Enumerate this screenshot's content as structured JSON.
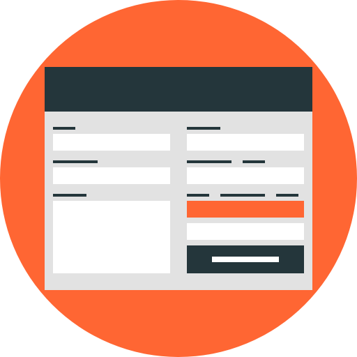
{
  "colors": {
    "background_circle": "#FF6633",
    "titlebar": "#24363B",
    "window_body": "#E2E2E2",
    "field": "#FFFFFF",
    "label": "#24363B",
    "accent_field": "#FF6633",
    "submit_button": "#24363B",
    "submit_label": "#FFFFFF"
  },
  "icon": {
    "name": "web-form-icon"
  }
}
